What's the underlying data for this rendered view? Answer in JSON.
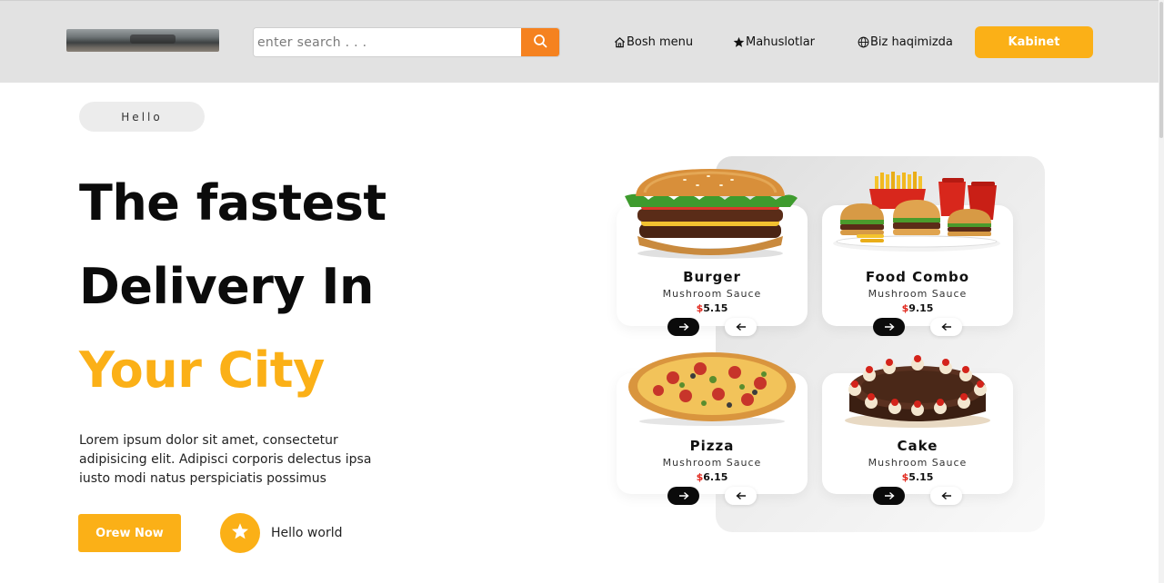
{
  "header": {
    "search_placeholder": "enter search . . .",
    "nav": [
      {
        "label": "Bosh menu",
        "icon": "home-icon"
      },
      {
        "label": "Mahuslotlar",
        "icon": "star-icon"
      },
      {
        "label": "Biz haqimizda",
        "icon": "globe-icon"
      }
    ],
    "cta_label": "Kabinet"
  },
  "hero": {
    "badge": "Hello",
    "title_line1": "The fastest",
    "title_line2": "Delivery In",
    "title_line3": "Your City",
    "description": "Lorem ipsum dolor sit amet, consectetur adipisicing elit. Adipisci corporis delectus ipsa iusto modi natus perspiciatis possimus",
    "order_label": "Orew Now",
    "secondary_label": "Hello world"
  },
  "cards": [
    {
      "name": "Burger",
      "subtitle": "Mushroom Sauce",
      "currency": "$",
      "price": "5.15"
    },
    {
      "name": "Food Combo",
      "subtitle": "Mushroom Sauce",
      "currency": "$",
      "price": "9.15"
    },
    {
      "name": "Pizza",
      "subtitle": "Mushroom Sauce",
      "currency": "$",
      "price": "6.15"
    },
    {
      "name": "Cake",
      "subtitle": "Mushroom Sauce",
      "currency": "$",
      "price": "5.15"
    }
  ],
  "colors": {
    "accent_yellow": "#fbb017",
    "search_orange": "#f58220",
    "header_bg": "#e2e2e2",
    "price_currency": "#e0261b"
  }
}
